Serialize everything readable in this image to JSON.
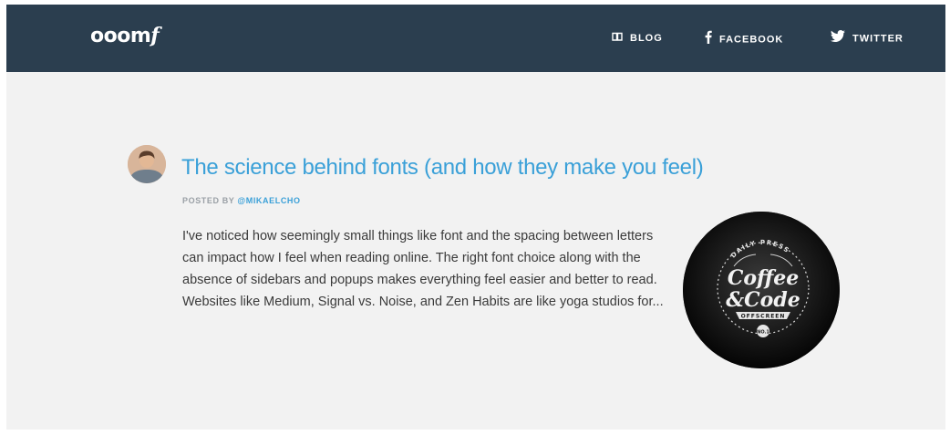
{
  "header": {
    "logo": {
      "text": "ooom",
      "script_letter": "f"
    },
    "nav": [
      {
        "label": "BLOG",
        "icon": "book-icon"
      },
      {
        "label": "FACEBOOK",
        "icon": "facebook-icon"
      },
      {
        "label": "TWITTER",
        "icon": "twitter-icon"
      }
    ]
  },
  "post": {
    "title": "The science behind fonts (and how they make you feel)",
    "byline_prefix": "POSTED BY",
    "author": "@MIKAELCHO",
    "excerpt": "I've noticed how seemingly small things like font and the spacing between letters can impact how I feel when reading online. The right font choice along with the absence of sidebars and popups makes everything feel easier and better to read. Websites like Medium, Signal vs. Noise, and Zen Habits are like yoga studios for...",
    "thumbnail": {
      "ring_text": "DAILY PRESS",
      "line1": "Coffee",
      "line2": "&Code",
      "ribbon": "OFFSCREEN",
      "badge": "NO.1"
    }
  },
  "colors": {
    "navbar": "#2b3e4f",
    "page_bg": "#f2f2f2",
    "accent": "#3aa0d8",
    "body_text": "#3a3a3a",
    "muted": "#9aa0a6"
  }
}
